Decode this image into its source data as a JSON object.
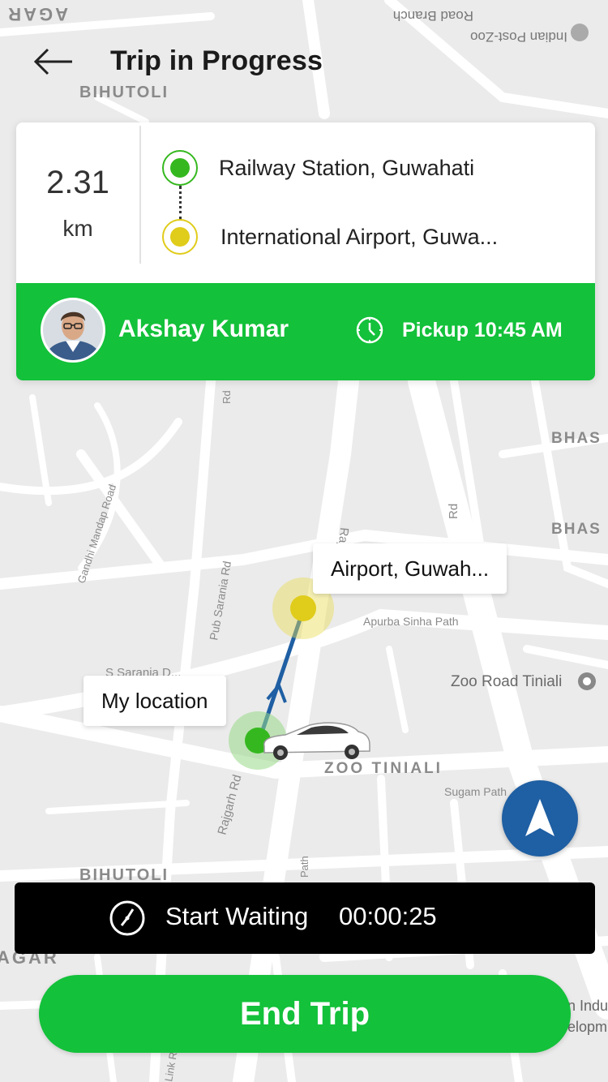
{
  "header": {
    "title": "Trip in Progress",
    "back_icon": "arrow-left-icon"
  },
  "trip": {
    "distance_value": "2.31",
    "distance_unit": "km",
    "pickup_location": "Railway Station, Guwahati",
    "drop_location": "International Airport, Guwa...",
    "pickup_dot_color": "#35b81f",
    "drop_dot_color": "#e0cc1a"
  },
  "driver": {
    "name": "Akshay Kumar",
    "pickup_time": "Pickup 10:45 AM",
    "clock_icon": "clock-icon"
  },
  "map": {
    "destination_label": "Airport, Guwah...",
    "my_location_label": "My location",
    "place_labels": {
      "bihutoli_top": "BIHUTOLI",
      "bihutoli_bottom": "BIHUTOLI",
      "nagar_top": "AGAR",
      "nagar_bottom": "AGAR",
      "bhas_1": "BHAS",
      "bhas_2": "BHAS",
      "zoo_tiniali_area": "ZOO TINIALI",
      "zoo_road_tiniali": "Zoo Road Tiniali",
      "apurba_sinha_path": "Apurba Sinha Path",
      "s_sarania": "S Sarania D...",
      "pub_sarania": "Pub Sarania Rd",
      "rajgarh_rd": "Rajgarh Rd",
      "sugam_path": "Sugam Path",
      "gandhi_mandap": "Gandhi Mandap Road",
      "road_branch": "Road Branch",
      "indian_post": "Indian Post-Zoo",
      "rajgarh_rd_mid": "Rajgarh Rd",
      "bhas_rd": "Rd",
      "path_small": "Path",
      "rd_small": "Rd",
      "link_rd": "Link Rd",
      "indu_partial": "n Indu",
      "elopm_partial": "elopm"
    }
  },
  "navigation": {
    "icon": "navigation-arrow-icon"
  },
  "waiting": {
    "label": "Start Waiting",
    "timer": "00:00:25",
    "icon": "timer-icon"
  },
  "actions": {
    "end_trip": "End Trip"
  },
  "colors": {
    "primary_green": "#13c13a",
    "nav_blue": "#1f5fa3",
    "route_blue": "#1f5fa3",
    "wait_bar_bg": "#000000"
  }
}
